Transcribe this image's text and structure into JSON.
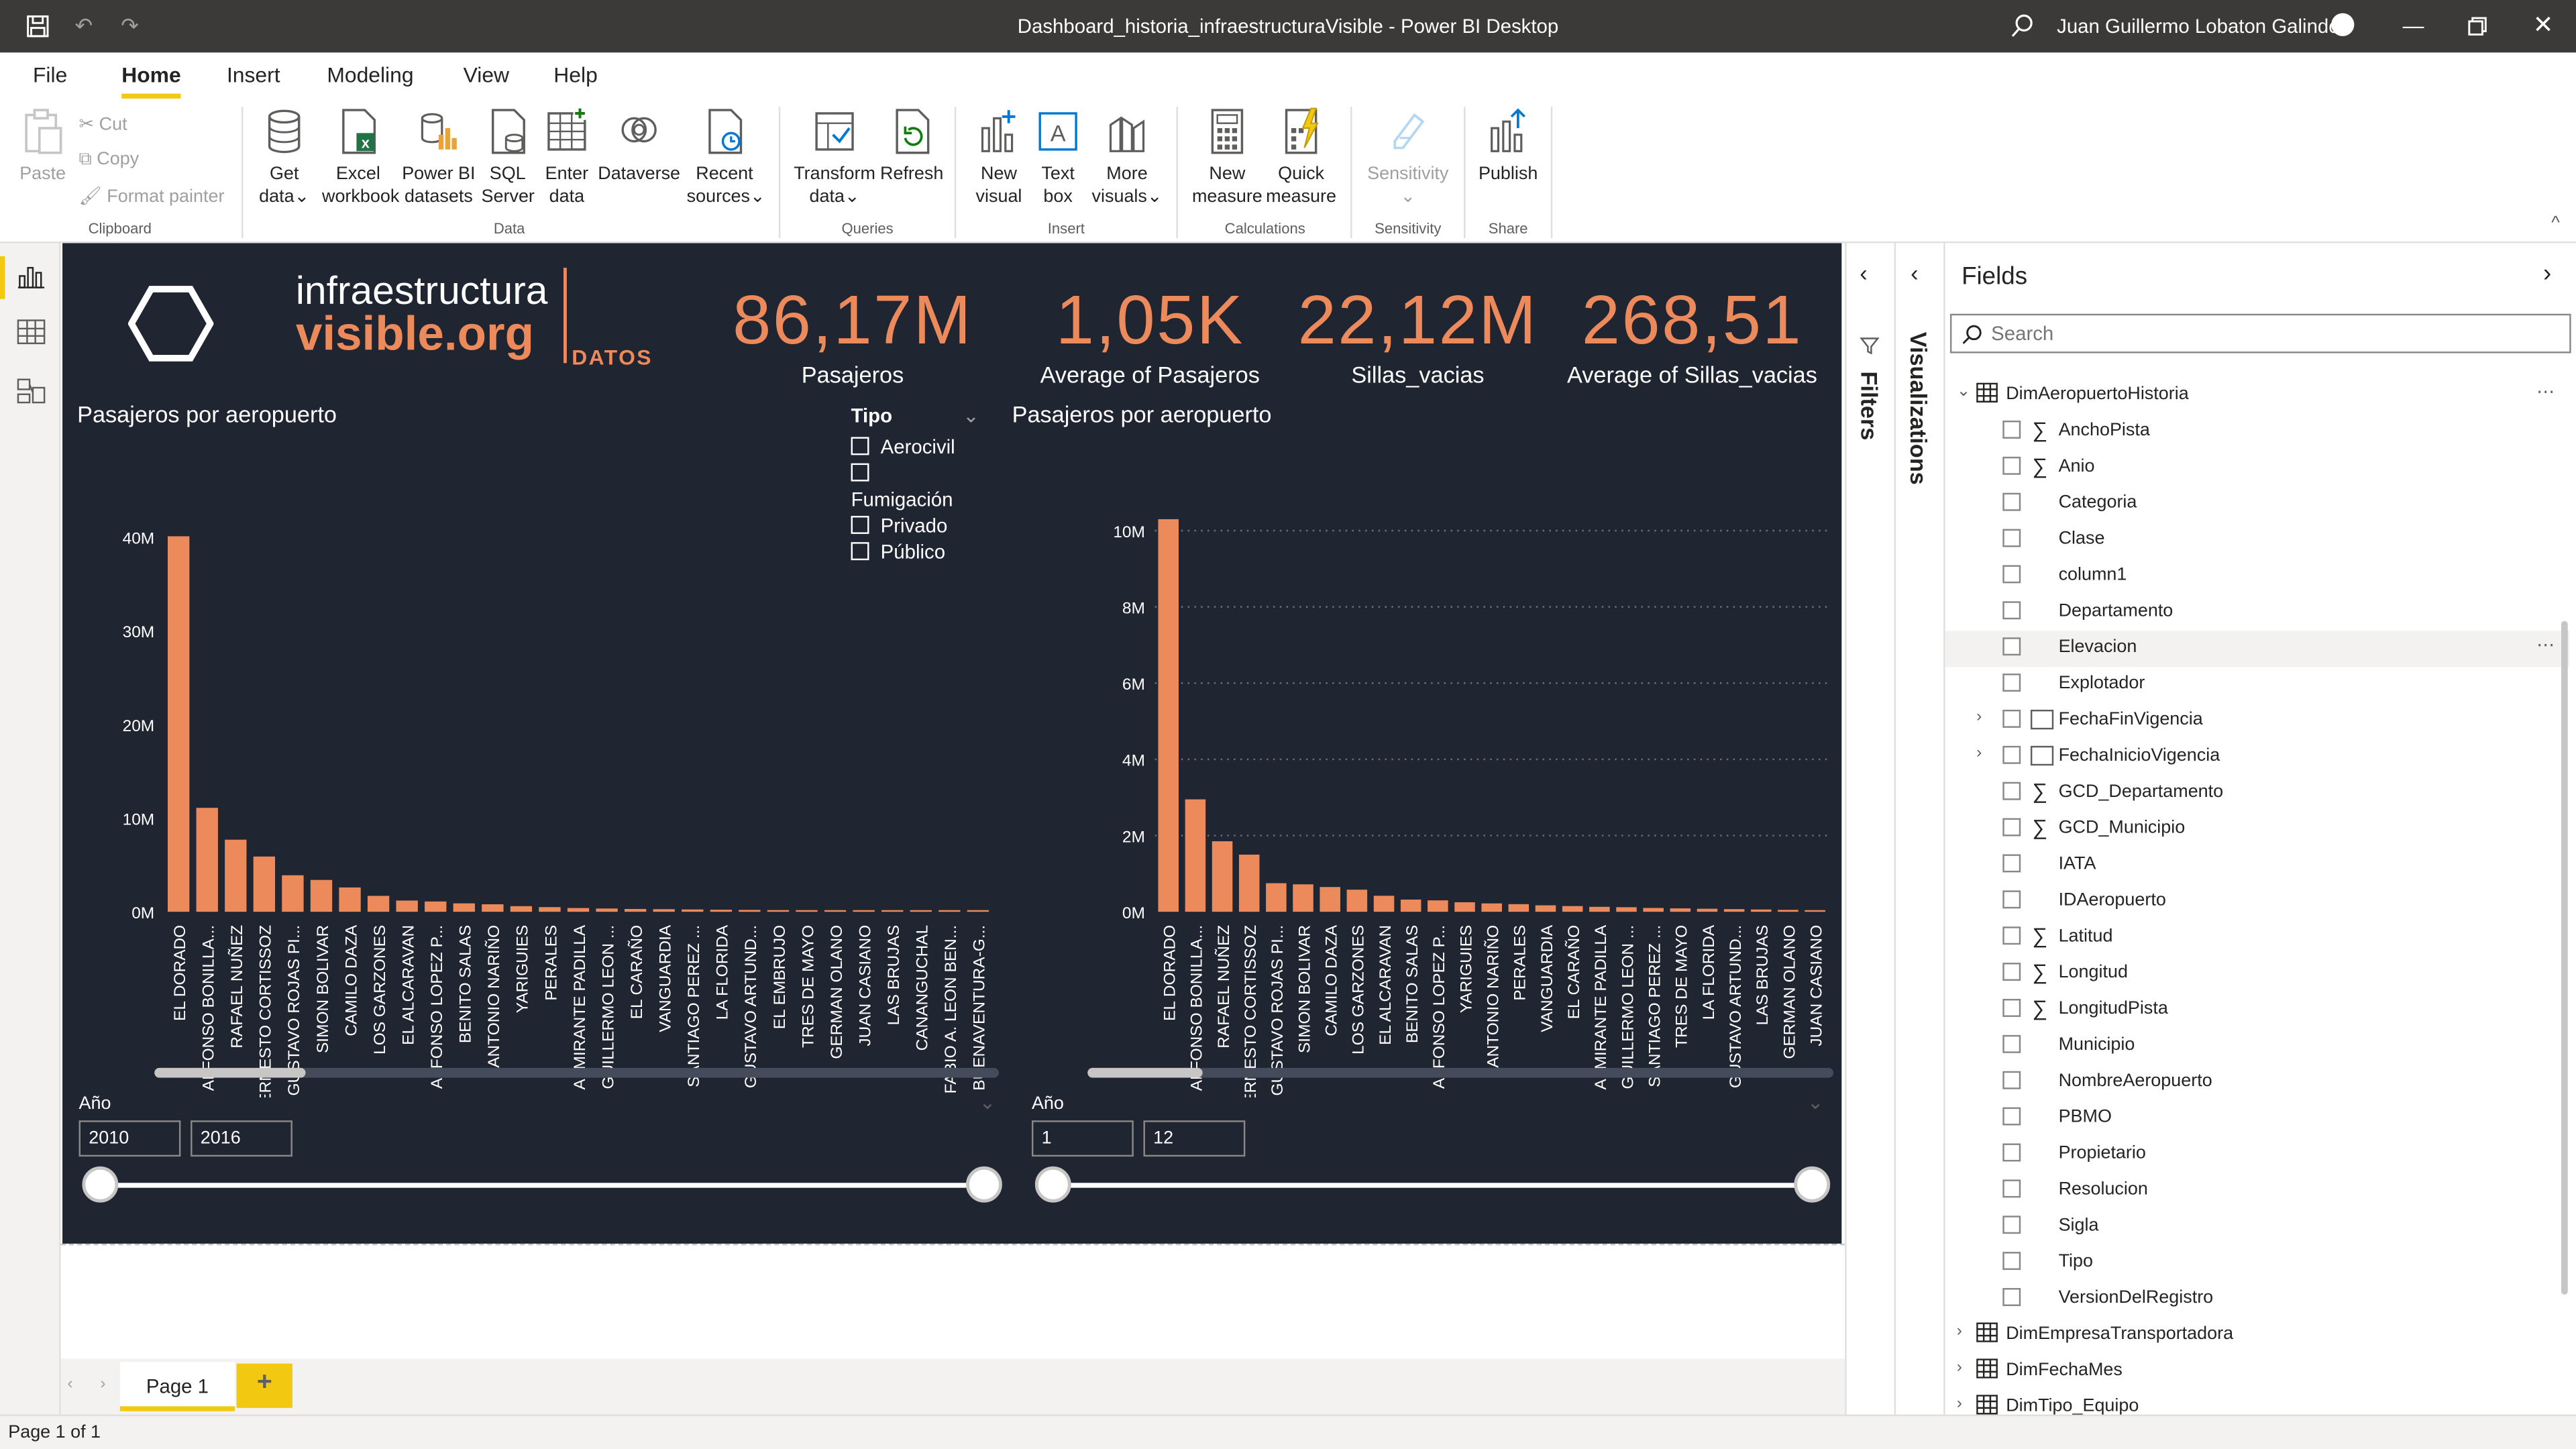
{
  "window": {
    "title": "Dashboard_historia_infraestructuraVisible - Power BI Desktop",
    "user": "Juan Guillermo Lobaton Galindo"
  },
  "menu": {
    "tabs": [
      "File",
      "Home",
      "Insert",
      "Modeling",
      "View",
      "Help"
    ],
    "active": "Home"
  },
  "ribbon": {
    "clipboard": {
      "paste": "Paste",
      "cut": "Cut",
      "copy": "Copy",
      "format_painter": "Format painter",
      "group": "Clipboard"
    },
    "data": {
      "get_data": [
        "Get",
        "data"
      ],
      "excel": [
        "Excel",
        "workbook"
      ],
      "pbi_datasets": [
        "Power BI",
        "datasets"
      ],
      "sql": [
        "SQL",
        "Server"
      ],
      "enter_data": [
        "Enter",
        "data"
      ],
      "dataverse": [
        "Dataverse",
        ""
      ],
      "recent": [
        "Recent",
        "sources"
      ],
      "group": "Data"
    },
    "queries": {
      "transform": [
        "Transform",
        "data"
      ],
      "refresh": [
        "Refresh",
        ""
      ],
      "group": "Queries"
    },
    "insert": {
      "new_visual": [
        "New",
        "visual"
      ],
      "text_box": [
        "Text",
        "box"
      ],
      "more_visuals": [
        "More",
        "visuals"
      ],
      "group": "Insert"
    },
    "calculations": {
      "new_measure": [
        "New",
        "measure"
      ],
      "quick_measure": [
        "Quick",
        "measure"
      ],
      "group": "Calculations"
    },
    "sensitivity": {
      "label": "Sensitivity",
      "group": "Sensitivity"
    },
    "share": {
      "publish": "Publish",
      "group": "Share"
    }
  },
  "report": {
    "logo": {
      "line1": "infraestructura",
      "line2": "visible.org",
      "tag": "DATOS"
    },
    "kpis": [
      {
        "value": "86,17M",
        "label": "Pasajeros"
      },
      {
        "value": "1,05K",
        "label": "Average of Pasajeros"
      },
      {
        "value": "22,12M",
        "label": "Sillas_vacias"
      },
      {
        "value": "268,51",
        "label": "Average of Sillas_vacias"
      }
    ],
    "slicer_tipo": {
      "title": "Tipo",
      "options": [
        "Aerocivil",
        "Fumigación",
        "Privado",
        "Público"
      ]
    },
    "slicer_anio_left": {
      "title": "Año",
      "from": "2010",
      "to": "2016"
    },
    "slicer_anio_right": {
      "title": "Año",
      "from": "1",
      "to": "12"
    },
    "bar_color": "#ed8a5c",
    "background": "#202532"
  },
  "chart_data": [
    {
      "type": "bar",
      "title": "Pasajeros por aeropuerto",
      "categories": [
        "EL DORADO",
        "ALFONSO BONILLA...",
        "RAFAEL NUÑEZ",
        "ERNESTO CORTISSOZ",
        "GUSTAVO ROJAS PI...",
        "SIMON BOLIVAR",
        "CAMILO DAZA",
        "LOS GARZONES",
        "EL ALCARAVAN",
        "ALFONSO LOPEZ P...",
        "BENITO SALAS",
        "ANTONIO NARIÑO",
        "YARIGUIES",
        "PERALES",
        "ALMIRANTE PADILLA",
        "GUILLERMO LEON ...",
        "EL CARAÑO",
        "VANGUARDIA",
        "SANTIAGO PEREZ ...",
        "LA FLORIDA",
        "GUSTAVO ARTUND...",
        "EL EMBRUJO",
        "TRES DE MAYO",
        "GERMAN OLANO",
        "JUAN CASIANO",
        "LAS BRUJAS",
        "CANANGUCHAL",
        "FABIO A. LEON BEN...",
        "BUENAVENTURA-G..."
      ],
      "values": [
        40.1,
        11.1,
        7.7,
        5.9,
        3.9,
        3.4,
        2.6,
        1.7,
        1.2,
        1.1,
        0.9,
        0.8,
        0.6,
        0.5,
        0.4,
        0.35,
        0.3,
        0.28,
        0.25,
        0.22,
        0.2,
        0.18,
        0.16,
        0.14,
        0.12,
        0.1,
        0.09,
        0.08,
        0.07
      ],
      "ylim": [
        0,
        40
      ],
      "yticks": [
        "0M",
        "10M",
        "20M",
        "30M",
        "40M"
      ],
      "unit": "M"
    },
    {
      "type": "bar",
      "title": "Pasajeros por aeropuerto",
      "categories": [
        "EL DORADO",
        "ALFONSO BONILLA...",
        "RAFAEL NUÑEZ",
        "ERNESTO CORTISSOZ",
        "GUSTAVO ROJAS PI...",
        "SIMON BOLIVAR",
        "CAMILO DAZA",
        "LOS GARZONES",
        "EL ALCARAVAN",
        "BENITO SALAS",
        "ALFONSO LOPEZ P...",
        "YARIGUIES",
        "ANTONIO NARIÑO",
        "PERALES",
        "VANGUARDIA",
        "EL CARAÑO",
        "ALMIRANTE PADILLA",
        "GUILLERMO LEON ...",
        "SANTIAGO PEREZ ...",
        "TRES DE MAYO",
        "LA FLORIDA",
        "GUSTAVO ARTUND...",
        "LAS BRUJAS",
        "GERMAN OLANO",
        "JUAN CASIANO"
      ],
      "values": [
        10.3,
        2.95,
        1.85,
        1.5,
        0.75,
        0.72,
        0.65,
        0.58,
        0.42,
        0.32,
        0.3,
        0.25,
        0.22,
        0.2,
        0.17,
        0.15,
        0.13,
        0.12,
        0.1,
        0.09,
        0.08,
        0.07,
        0.06,
        0.05,
        0.04
      ],
      "ylim": [
        0,
        10
      ],
      "yticks": [
        "0M",
        "2M",
        "4M",
        "6M",
        "8M",
        "10M"
      ],
      "unit": "M",
      "grid": true
    }
  ],
  "panes": {
    "filters": "Filters",
    "visualizations": "Visualizations",
    "fields": {
      "title": "Fields",
      "search_placeholder": "Search",
      "tables": [
        {
          "name": "DimAeropuertoHistoria",
          "expanded": true,
          "fields": [
            {
              "name": "AnchoPista",
              "sigma": true
            },
            {
              "name": "Anio",
              "sigma": true
            },
            {
              "name": "Categoria"
            },
            {
              "name": "Clase"
            },
            {
              "name": "column1"
            },
            {
              "name": "Departamento"
            },
            {
              "name": "Elevacion",
              "hover": true
            },
            {
              "name": "Explotador"
            },
            {
              "name": "FechaFinVigencia",
              "calendar": true
            },
            {
              "name": "FechaInicioVigencia",
              "calendar": true
            },
            {
              "name": "GCD_Departamento",
              "sigma": true
            },
            {
              "name": "GCD_Municipio",
              "sigma": true
            },
            {
              "name": "IATA"
            },
            {
              "name": "IDAeropuerto"
            },
            {
              "name": "Latitud",
              "sigma": true
            },
            {
              "name": "Longitud",
              "sigma": true
            },
            {
              "name": "LongitudPista",
              "sigma": true
            },
            {
              "name": "Municipio"
            },
            {
              "name": "NombreAeropuerto"
            },
            {
              "name": "PBMO"
            },
            {
              "name": "Propietario"
            },
            {
              "name": "Resolucion"
            },
            {
              "name": "Sigla"
            },
            {
              "name": "Tipo"
            },
            {
              "name": "VersionDelRegistro"
            }
          ]
        },
        {
          "name": "DimEmpresaTransportadora"
        },
        {
          "name": "DimFechaMes"
        },
        {
          "name": "DimTipo_Equipo"
        }
      ]
    }
  },
  "pages": {
    "tab": "Page 1",
    "status": "Page 1 of 1"
  }
}
